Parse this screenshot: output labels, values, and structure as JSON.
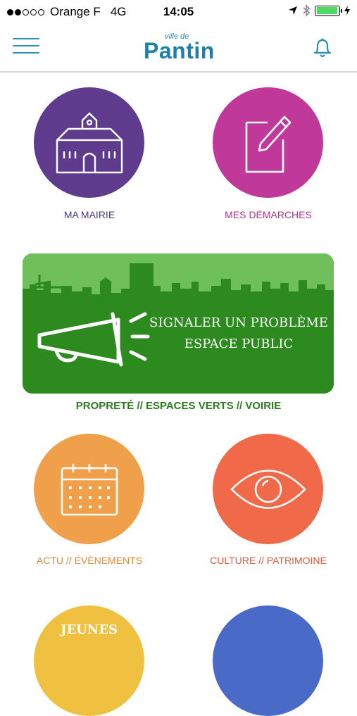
{
  "status_bar": {
    "carrier": "Orange F",
    "network": "4G",
    "time": "14:05",
    "battery_level": 0.95
  },
  "header": {
    "logo_small": "ville de",
    "logo_main": "Pantin",
    "menu_icon": "hamburger-menu-icon",
    "bell_icon": "bell-icon"
  },
  "tiles": {
    "ma_mairie": {
      "label": "MA MAIRIE",
      "color": "#5e3b8c",
      "label_color": "#4a3a7a",
      "icon": "town-hall-icon"
    },
    "mes_demarches": {
      "label": "MES DÉMARCHES",
      "color": "#c0399a",
      "label_color": "#b03590",
      "icon": "edit-form-icon"
    },
    "actu": {
      "label": "ACTU // ÉVÈNEMENTS",
      "color": "#f0a04a",
      "label_color": "#e08a3a",
      "icon": "calendar-icon"
    },
    "culture": {
      "label": "CULTURE // PATRIMOINE",
      "color": "#f06a4a",
      "label_color": "#e05a3a",
      "icon": "eye-icon"
    },
    "jeunes": {
      "label": "JEUNES",
      "color": "#f0c040"
    },
    "bottom_right": {
      "color": "#4a6ac8"
    }
  },
  "banner": {
    "line1": "SIGNALER UN PROBLÈME",
    "line2": "ESPACE PUBLIC",
    "subtitle": "PROPRETÉ // ESPACES VERTS // VOIRIE",
    "bg_color": "#2c8a1e",
    "sky_color": "#6fc05a",
    "icon": "megaphone-icon"
  }
}
